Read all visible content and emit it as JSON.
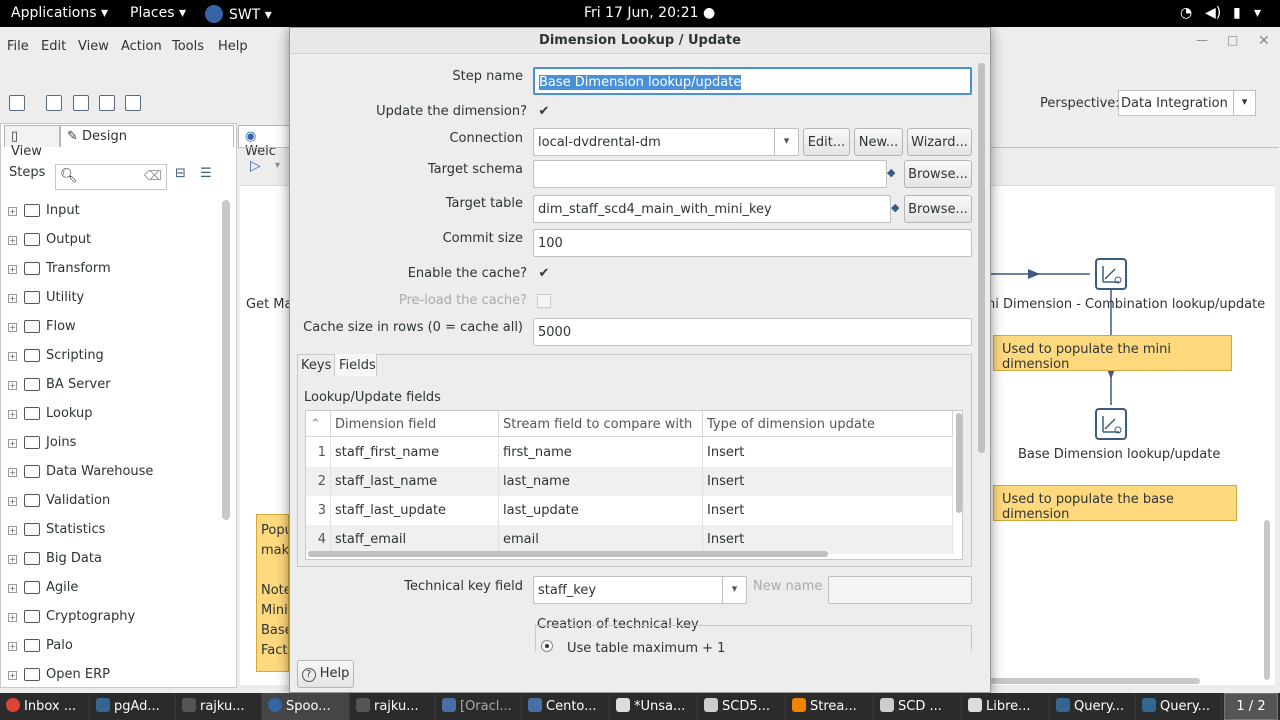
{
  "top_panel": {
    "applications": "Applications",
    "places": "Places",
    "app_name": "SWT",
    "clock": "Fri 17 Jun, 20:21"
  },
  "main_window": {
    "menu": [
      "File",
      "Edit",
      "View",
      "Action",
      "Tools",
      "Help"
    ],
    "perspective_label": "Perspective:",
    "perspective_value": "Data Integration",
    "tab_view": "View",
    "tab_design": "Design",
    "welcome_tab": "Welc",
    "steps_label": "Steps",
    "step_folders": [
      "Input",
      "Output",
      "Transform",
      "Utility",
      "Flow",
      "Scripting",
      "BA Server",
      "Lookup",
      "Joins",
      "Data Warehouse",
      "Validation",
      "Statistics",
      "Big Data",
      "Agile",
      "Cryptography",
      "Palo",
      "Open ERP"
    ]
  },
  "canvas": {
    "partial_step_label": "Get Ma",
    "mini_step_label": "ni Dimension - Combination lookup/update",
    "base_step_label": "Base Dimension lookup/update",
    "note_mini": "Used to populate the mini dimension",
    "note_base": "Used to populate the base dimension",
    "left_note_lines": [
      "Popu",
      "make",
      "",
      "Note",
      "Mini",
      "Base",
      "Fact"
    ]
  },
  "dialog": {
    "title": "Dimension Lookup / Update",
    "step_name_label": "Step name",
    "step_name_value": "Base Dimension lookup/update",
    "update_dimension_label": "Update the dimension?",
    "connection_label": "Connection",
    "connection_value": "local-dvdrental-dm",
    "edit_btn": "Edit...",
    "new_btn": "New...",
    "wizard_btn": "Wizard...",
    "target_schema_label": "Target schema",
    "target_schema_value": "",
    "browse_btn": "Browse...",
    "target_table_label": "Target table",
    "target_table_value": "dim_staff_scd4_main_with_mini_key",
    "commit_size_label": "Commit size",
    "commit_size_value": "100",
    "enable_cache_label": "Enable the cache?",
    "preload_cache_label": "Pre-load the cache?",
    "cache_size_label": "Cache size in rows (0 = cache all)",
    "cache_size_value": "5000",
    "tab_keys": "Keys",
    "tab_fields": "Fields",
    "fields_group_label": "Lookup/Update fields",
    "columns": [
      "Dimension field",
      "Stream field to compare with",
      "Type of dimension update"
    ],
    "rows": [
      {
        "n": "1",
        "dim": "staff_first_name",
        "stream": "first_name",
        "type": "Insert"
      },
      {
        "n": "2",
        "dim": "staff_last_name",
        "stream": "last_name",
        "type": "Insert"
      },
      {
        "n": "3",
        "dim": "staff_last_update",
        "stream": "last_update",
        "type": "Insert"
      },
      {
        "n": "4",
        "dim": "staff_email",
        "stream": "email",
        "type": "Insert"
      }
    ],
    "tech_key_label": "Technical key field",
    "tech_key_value": "staff_key",
    "new_name_label": "New name",
    "creation_group_label": "Creation of technical key",
    "use_table_max": "Use table maximum + 1",
    "help_btn": "Help"
  },
  "taskbar": {
    "tasks": [
      "Inbox ...",
      "pgAd...",
      "rajku...",
      "Spoo...",
      "rajku...",
      "[Oracl...",
      "Cento...",
      "*Unsa...",
      "SCD5...",
      "Strea...",
      "SCD ...",
      "Libre...",
      "Query...",
      "Query..."
    ],
    "pager": "1 / 2"
  }
}
